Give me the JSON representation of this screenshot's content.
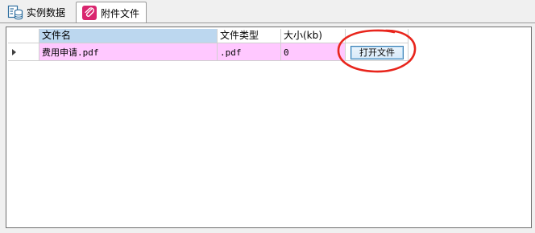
{
  "tabs": [
    {
      "label": "实例数据",
      "icon": "database-icon",
      "active": false
    },
    {
      "label": "附件文件",
      "icon": "attachment-icon",
      "active": true
    }
  ],
  "grid": {
    "columns": [
      "文件名",
      "文件类型",
      "大小(kb)"
    ],
    "rows": [
      {
        "file_name": "费用申请.pdf",
        "file_type": ".pdf",
        "size": "0",
        "action": "打开文件"
      }
    ]
  },
  "colors": {
    "selected_header": "#bcd7ef",
    "row_highlight": "#ffc8ff",
    "annotation": "#e8251c",
    "attachment_icon": "#d9266f"
  }
}
